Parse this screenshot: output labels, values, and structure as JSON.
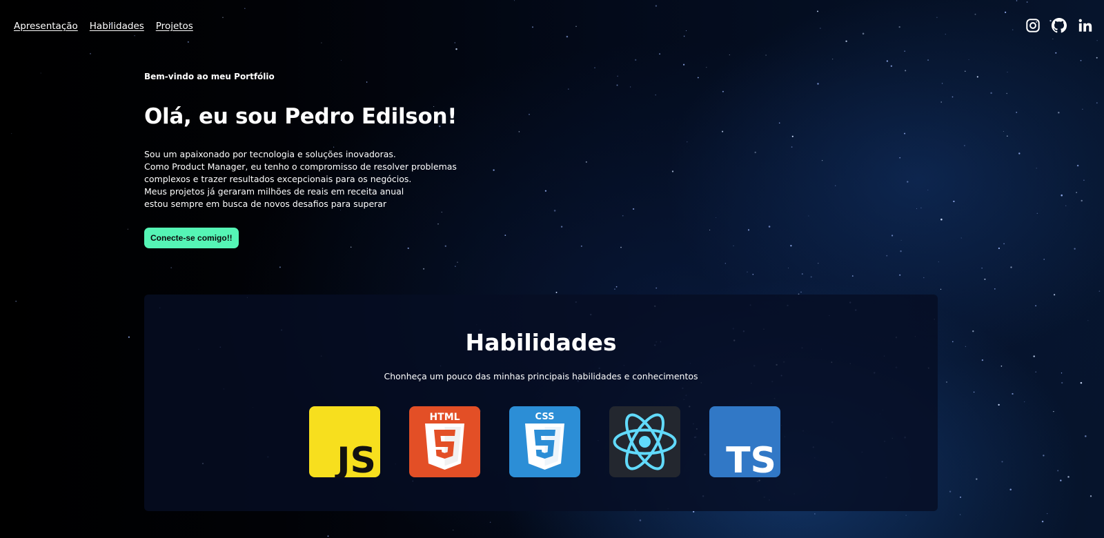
{
  "nav": {
    "items": [
      {
        "label": "Apresentação"
      },
      {
        "label": "Habilidades"
      },
      {
        "label": "Projetos"
      }
    ]
  },
  "social": {
    "icons": [
      "instagram-icon",
      "github-icon",
      "linkedin-icon"
    ]
  },
  "hero": {
    "kicker": "Bem-vindo ao meu Portfólio",
    "title": "Olá, eu sou Pedro Edilson!",
    "bio_lines": [
      "Sou um apaixonado por tecnologia e soluções inovadoras.",
      "Como Product Manager, eu tenho o compromisso de resolver problemas",
      "complexos e trazer resultados excepcionais para os negócios.",
      "Meus projetos já geraram milhões de reais em receita anual",
      "estou sempre em busca de novos desafios para superar"
    ],
    "cta_label": "Conecte-se comigo!!"
  },
  "skills": {
    "title": "Habilidades",
    "subtitle": "Chonheça um pouco das minhas principais habilidades e conhecimentos",
    "items": [
      {
        "icon": "javascript-icon",
        "text": "JS",
        "color": "#f7df1e"
      },
      {
        "icon": "html5-icon",
        "text": "HTML",
        "color": "#e34f26"
      },
      {
        "icon": "css3-icon",
        "text": "CSS",
        "color": "#2c8ed6"
      },
      {
        "icon": "react-icon",
        "color": "#61dafb"
      },
      {
        "icon": "typescript-icon",
        "text": "TS",
        "color": "#3178c6"
      }
    ]
  },
  "colors": {
    "accent": "#55f5b5",
    "background": "#000000"
  }
}
